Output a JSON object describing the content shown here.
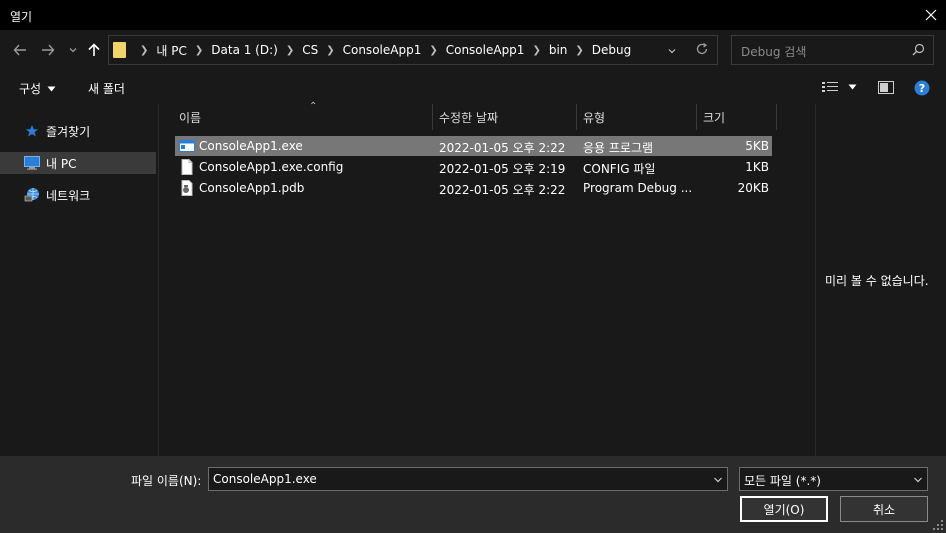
{
  "window": {
    "title": "열기"
  },
  "nav": {
    "back_icon": "arrow-left-icon",
    "forward_icon": "arrow-right-icon",
    "recent_icon": "chevron-down-icon",
    "up_icon": "arrow-up-icon"
  },
  "address": {
    "crumbs": [
      "내 PC",
      "Data 1 (D:)",
      "CS",
      "ConsoleApp1",
      "ConsoleApp1",
      "bin",
      "Debug"
    ]
  },
  "search": {
    "placeholder": "Debug 검색"
  },
  "toolbar": {
    "organize_label": "구성",
    "new_folder_label": "새 폴더"
  },
  "sidebar": {
    "items": [
      {
        "label": "즐겨찾기",
        "icon": "star-icon"
      },
      {
        "label": "내 PC",
        "icon": "computer-icon",
        "selected": true
      },
      {
        "label": "네트워크",
        "icon": "network-icon"
      }
    ]
  },
  "file_list": {
    "columns": [
      "이름",
      "수정한 날짜",
      "유형",
      "크기"
    ],
    "rows": [
      {
        "name": "ConsoleApp1.exe",
        "date": "2022-01-05 오후 2:22",
        "type": "응용 프로그램",
        "size": "5KB",
        "icon": "application-icon",
        "selected": true
      },
      {
        "name": "ConsoleApp1.exe.config",
        "date": "2022-01-05 오후 2:19",
        "type": "CONFIG 파일",
        "size": "1KB",
        "icon": "document-icon"
      },
      {
        "name": "ConsoleApp1.pdb",
        "date": "2022-01-05 오후 2:22",
        "type": "Program Debug ...",
        "size": "20KB",
        "icon": "debug-file-icon"
      }
    ]
  },
  "preview": {
    "message": "미리 볼 수 없습니다."
  },
  "footer": {
    "filename_label": "파일 이름(N):",
    "filename_value": "ConsoleApp1.exe",
    "filetype_value": "모든 파일 (*.*)",
    "open_label": "열기(O)",
    "cancel_label": "취소"
  },
  "colors": {
    "background": "#191919",
    "selection": "#777777",
    "accent_blue": "#2a7fd4",
    "folder_yellow": "#f3d36b"
  }
}
